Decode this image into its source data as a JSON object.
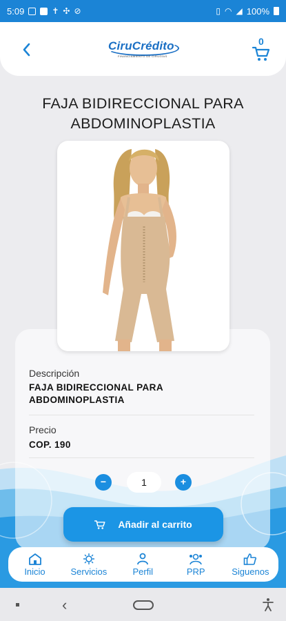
{
  "status_bar": {
    "time": "5:09",
    "battery": "100%"
  },
  "header": {
    "logo_text": "CiruCrédito",
    "logo_tagline": "FINANCIAMIENTO DE CIRUGÍAS",
    "cart_count": "0"
  },
  "product": {
    "title": "FAJA BIDIRECCIONAL PARA ABDOMINOPLASTIA",
    "description_label": "Descripción",
    "description": "FAJA BIDIRECCIONAL PARA ABDOMINOPLASTIA",
    "price_label": "Precio",
    "price": "COP. 190",
    "quantity": "1",
    "quantity_minus": "−",
    "quantity_plus": "+",
    "add_to_cart": "Añadir al carrito"
  },
  "bottom_nav": {
    "items": [
      {
        "label": "Inicio",
        "icon": "home-icon"
      },
      {
        "label": "Servicios",
        "icon": "services-icon"
      },
      {
        "label": "Perfil",
        "icon": "profile-icon"
      },
      {
        "label": "PRP",
        "icon": "prp-icon"
      },
      {
        "label": "Siguenos",
        "icon": "thumbs-up-icon"
      }
    ]
  },
  "colors": {
    "primary": "#1b84d6",
    "button": "#1b95e5",
    "background": "#ececef"
  }
}
